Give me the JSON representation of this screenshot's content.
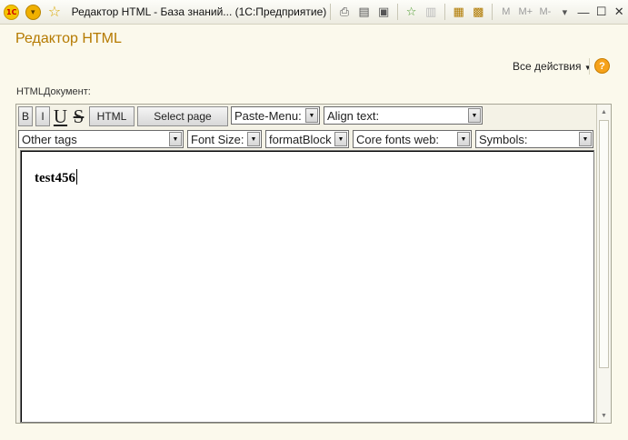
{
  "window": {
    "title": "Редактор HTML - База знаний... (1С:Предприятие)",
    "logo": "1c-logo-icon",
    "memory_buttons": [
      "M",
      "M+",
      "M-"
    ]
  },
  "form": {
    "title": "Редактор HTML",
    "all_actions": "Все действия",
    "help": "?",
    "field_label": "HTMLДокумент:"
  },
  "toolbar_row1": {
    "bold": "B",
    "italic": "I",
    "underline": "U",
    "strike": "S",
    "html": "HTML",
    "select_page": "Select page",
    "paste_menu": "Paste-Menu:",
    "align_text": "Align text:"
  },
  "toolbar_row2": {
    "other_tags": "Other tags",
    "font_size": "Font Size:",
    "format_block": "formatBlock",
    "core_fonts": "Core fonts web:",
    "symbols": "Symbols:"
  },
  "editor": {
    "content": "test456"
  }
}
